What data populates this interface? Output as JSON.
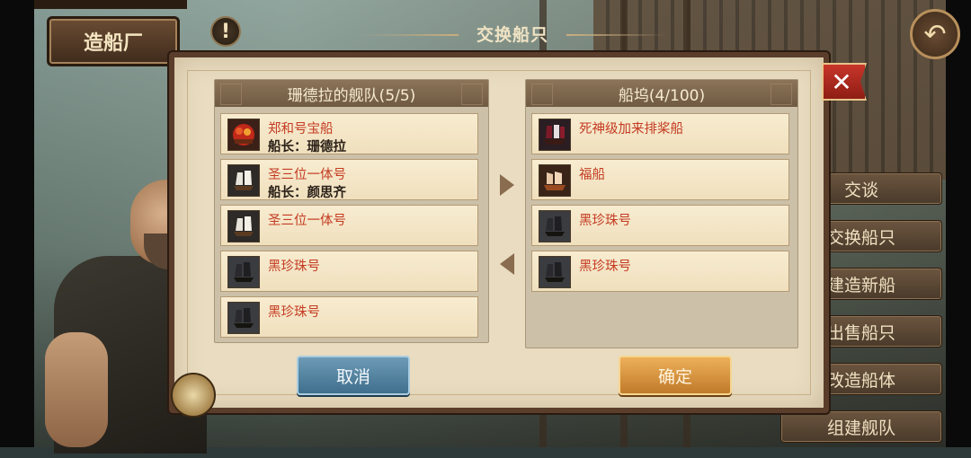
{
  "header": {
    "location_sign": "造船厂",
    "alert_symbol": "!",
    "back_symbol": "↶"
  },
  "dialog": {
    "title": "交换船只",
    "close_symbol": "✕",
    "fleet": {
      "header": "珊德拉的舰队(5/5)",
      "ships": [
        {
          "name": "郑和号宝船",
          "captain": "船长：珊德拉",
          "icon": "treasure-ship-icon"
        },
        {
          "name": "圣三位一体号",
          "captain": "船长：颜思齐",
          "icon": "sailing-ship-icon"
        },
        {
          "name": "圣三位一体号",
          "captain": "",
          "icon": "sailing-ship-icon"
        },
        {
          "name": "黑珍珠号",
          "captain": "",
          "icon": "black-pearl-ship-icon"
        },
        {
          "name": "黑珍珠号",
          "captain": "",
          "icon": "black-pearl-ship-icon"
        }
      ]
    },
    "dock": {
      "header": "船坞(4/100)",
      "ships": [
        {
          "name": "死神级加来排桨船",
          "icon": "galley-ship-icon"
        },
        {
          "name": "福船",
          "icon": "fu-ship-icon"
        },
        {
          "name": "黑珍珠号",
          "icon": "black-pearl-ship-icon"
        },
        {
          "name": "黑珍珠号",
          "icon": "black-pearl-ship-icon"
        }
      ]
    },
    "cancel_label": "取消",
    "confirm_label": "确定"
  },
  "side_menu": [
    {
      "label": "交谈"
    },
    {
      "label": "交换船只"
    },
    {
      "label": "建造新船"
    },
    {
      "label": "出售船只"
    },
    {
      "label": "改造船体"
    },
    {
      "label": "组建舰队"
    }
  ],
  "colors": {
    "ship_name": "#c43b22",
    "panel_bg": "#e9dcc0",
    "confirm": "#d8922f",
    "cancel": "#5585a3",
    "close": "#b12a1f"
  }
}
